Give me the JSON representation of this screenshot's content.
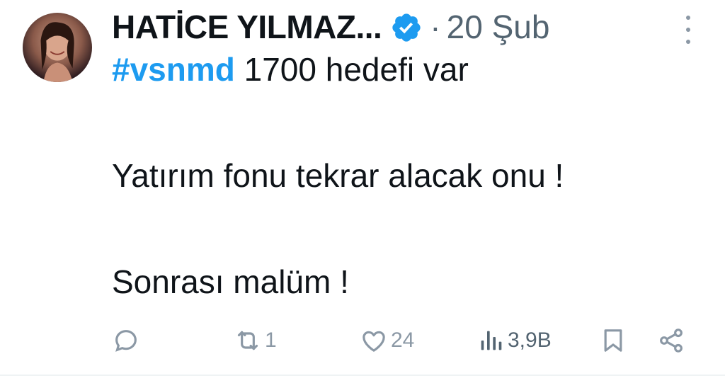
{
  "author": {
    "display_name": "HATİCE YILMAZ...",
    "verified": true,
    "separator": "·",
    "date": "20 Şub"
  },
  "tweet": {
    "hashtag": "#vsnmd",
    "first_line_rest": " 1700 hedefi var",
    "line2": "Yatırım fonu tekrar alacak onu !",
    "line3": "Sonrası malüm !"
  },
  "actions": {
    "reply_count": "",
    "retweet_count": "1",
    "like_count": "24",
    "views_count": "3,9B"
  },
  "colors": {
    "link": "#1d9bf0",
    "muted": "#536471",
    "icon": "#8b98a5"
  },
  "icons": [
    "verified-badge-icon",
    "more-icon",
    "reply-icon",
    "retweet-icon",
    "like-icon",
    "views-icon",
    "bookmark-icon",
    "share-icon"
  ]
}
